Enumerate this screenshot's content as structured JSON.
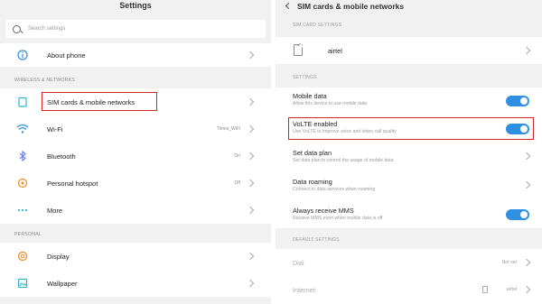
{
  "left": {
    "title": "Settings",
    "search_placeholder": "Search settings",
    "top_item": {
      "label": "About phone",
      "icon": "info-icon"
    },
    "wireless_header": "WIRELESS & NETWORKS",
    "wireless_items": [
      {
        "label": "SIM cards & mobile networks",
        "value": "",
        "icon": "sim-icon"
      },
      {
        "label": "Wi-Fi",
        "value": "Times_WiFi",
        "icon": "wifi-icon"
      },
      {
        "label": "Bluetooth",
        "value": "On",
        "icon": "bluetooth-icon"
      },
      {
        "label": "Personal hotspot",
        "value": "Off",
        "icon": "hotspot-icon"
      },
      {
        "label": "More",
        "value": "",
        "icon": "more-icon"
      }
    ],
    "personal_header": "PERSONAL",
    "personal_items": [
      {
        "label": "Display",
        "icon": "display-icon"
      },
      {
        "label": "Wallpaper",
        "icon": "wallpaper-icon"
      }
    ]
  },
  "right": {
    "title": "SIM cards & mobile networks",
    "sim_header": "SIM CARD SETTINGS",
    "sim_name": "airtel",
    "settings_header": "SETTINGS",
    "settings": [
      {
        "title": "Mobile data",
        "sub": "Allow this device to use mobile data",
        "control": "toggle",
        "on": true
      },
      {
        "title": "VoLTE enabled",
        "sub": "Use VoLTE to improve voice and video call quality",
        "control": "toggle",
        "on": true
      },
      {
        "title": "Set data plan",
        "sub": "Set data plan to control the usage of mobile data",
        "control": "chevron"
      },
      {
        "title": "Data roaming",
        "sub": "Connect to data services when roaming",
        "control": "chevron"
      },
      {
        "title": "Always receive MMS",
        "sub": "Receive MMS even when mobile data is off",
        "control": "toggle",
        "on": true
      }
    ],
    "default_header": "DEFAULT SETTINGS",
    "defaults": [
      {
        "title": "Dial",
        "value": "Not set"
      },
      {
        "title": "Internet",
        "value": "airtel"
      }
    ]
  },
  "colors": {
    "accent": "#2f8fe3",
    "highlight": "#d32424",
    "background": "#f1f1f1"
  }
}
